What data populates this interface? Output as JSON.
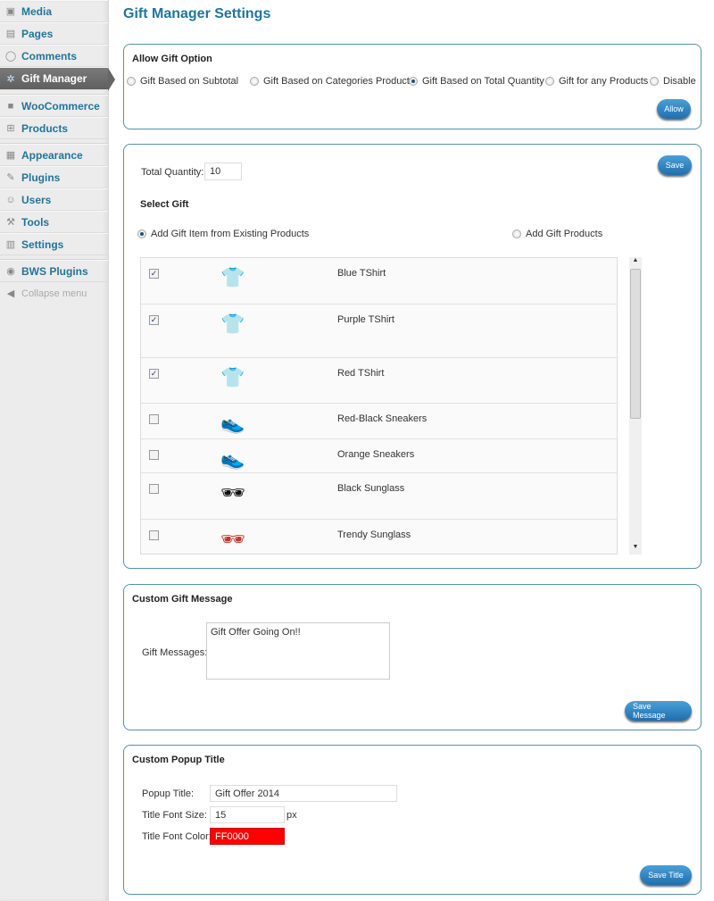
{
  "sidebar": {
    "items": [
      {
        "label": "Media",
        "icon": "media-icon"
      },
      {
        "label": "Pages",
        "icon": "pages-icon"
      },
      {
        "label": "Comments",
        "icon": "comments-icon"
      },
      {
        "label": "Gift Manager",
        "icon": "gear-icon",
        "active": true
      },
      {
        "label": "WooCommerce",
        "icon": "woocommerce-icon"
      },
      {
        "label": "Products",
        "icon": "cart-icon"
      },
      {
        "label": "Appearance",
        "icon": "appearance-icon"
      },
      {
        "label": "Plugins",
        "icon": "plugins-icon"
      },
      {
        "label": "Users",
        "icon": "users-icon"
      },
      {
        "label": "Tools",
        "icon": "tools-icon"
      },
      {
        "label": "Settings",
        "icon": "settings-icon"
      },
      {
        "label": "BWS Plugins",
        "icon": "bws-icon"
      }
    ],
    "collapse": "Collapse menu"
  },
  "page_title": "Gift Manager Settings",
  "allow": {
    "title": "Allow Gift Option",
    "options": [
      "Gift Based on Subtotal",
      "Gift Based on Categories Products",
      "Gift Based on Total Quantity",
      "Gift for any Products",
      "Disable"
    ],
    "selected": "Gift Based on Total Quantity",
    "button": "Allow"
  },
  "gift": {
    "quantity_label": "Total Quantity:",
    "quantity": "10",
    "save": "Save",
    "select_title": "Select Gift",
    "source_options": [
      "Add Gift Item from Existing Products",
      "Add Gift Products"
    ],
    "source_selected": "Add Gift Item from Existing Products",
    "products": [
      {
        "name": "Blue TShirt",
        "checked": true,
        "icon": "tshirt-icon",
        "color": "#1a8fc4"
      },
      {
        "name": "Purple TShirt",
        "checked": true,
        "icon": "polo-shirt-icon",
        "color": "#6a2bb0"
      },
      {
        "name": "Red TShirt",
        "checked": true,
        "icon": "tshirt-icon",
        "color": "#d01f2a"
      },
      {
        "name": "Red-Black Sneakers",
        "checked": false,
        "icon": "sneaker-icon",
        "color": "#c02020"
      },
      {
        "name": "Orange Sneakers",
        "checked": false,
        "icon": "sneaker-icon",
        "color": "#e8632a"
      },
      {
        "name": "Black Sunglass",
        "checked": false,
        "icon": "sunglasses-icon",
        "color": "#111111"
      },
      {
        "name": "Trendy Sunglass",
        "checked": false,
        "icon": "sunglasses-icon",
        "color": "#c0392b"
      }
    ]
  },
  "message": {
    "title": "Custom Gift Message",
    "label": "Gift Messages:",
    "value": "Gift Offer Going On!!",
    "button": "Save Message"
  },
  "popup": {
    "title": "Custom Popup Title",
    "title_label": "Popup Title:",
    "title_value": "Gift Offer 2014",
    "size_label": "Title Font Size:",
    "size_value": "15",
    "size_unit": "px",
    "color_label": "Title Font Color:",
    "color_value": "FF0000",
    "color_hex": "#FF0000",
    "button": "Save Title"
  }
}
